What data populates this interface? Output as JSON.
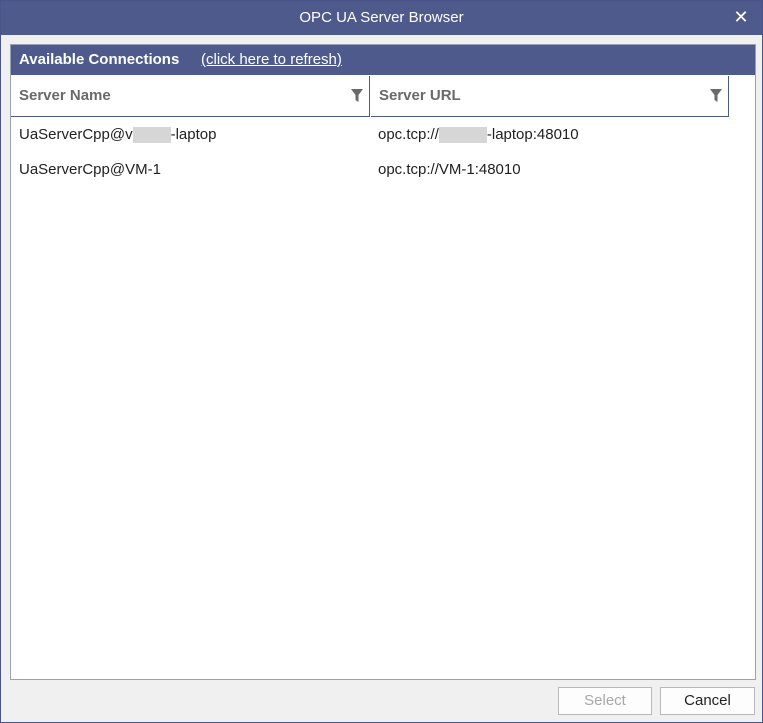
{
  "window": {
    "title": "OPC UA Server Browser",
    "close_glyph": "✕"
  },
  "panel": {
    "title": "Available Connections",
    "refresh_link": "(click here to refresh)"
  },
  "columns": {
    "name": "Server Name",
    "url": "Server URL"
  },
  "rows": [
    {
      "name_prefix": "UaServerCpp@v",
      "name_suffix": "-laptop",
      "url_prefix": "opc.tcp://",
      "url_suffix": "-laptop:48010"
    },
    {
      "name_prefix": "UaServerCpp@VM-1",
      "name_suffix": "",
      "url_prefix": "opc.tcp://VM-1:48010",
      "url_suffix": ""
    }
  ],
  "buttons": {
    "select": "Select",
    "cancel": "Cancel"
  },
  "colors": {
    "accent": "#4e5a8c",
    "disabled_text": "#a8a8a8"
  }
}
